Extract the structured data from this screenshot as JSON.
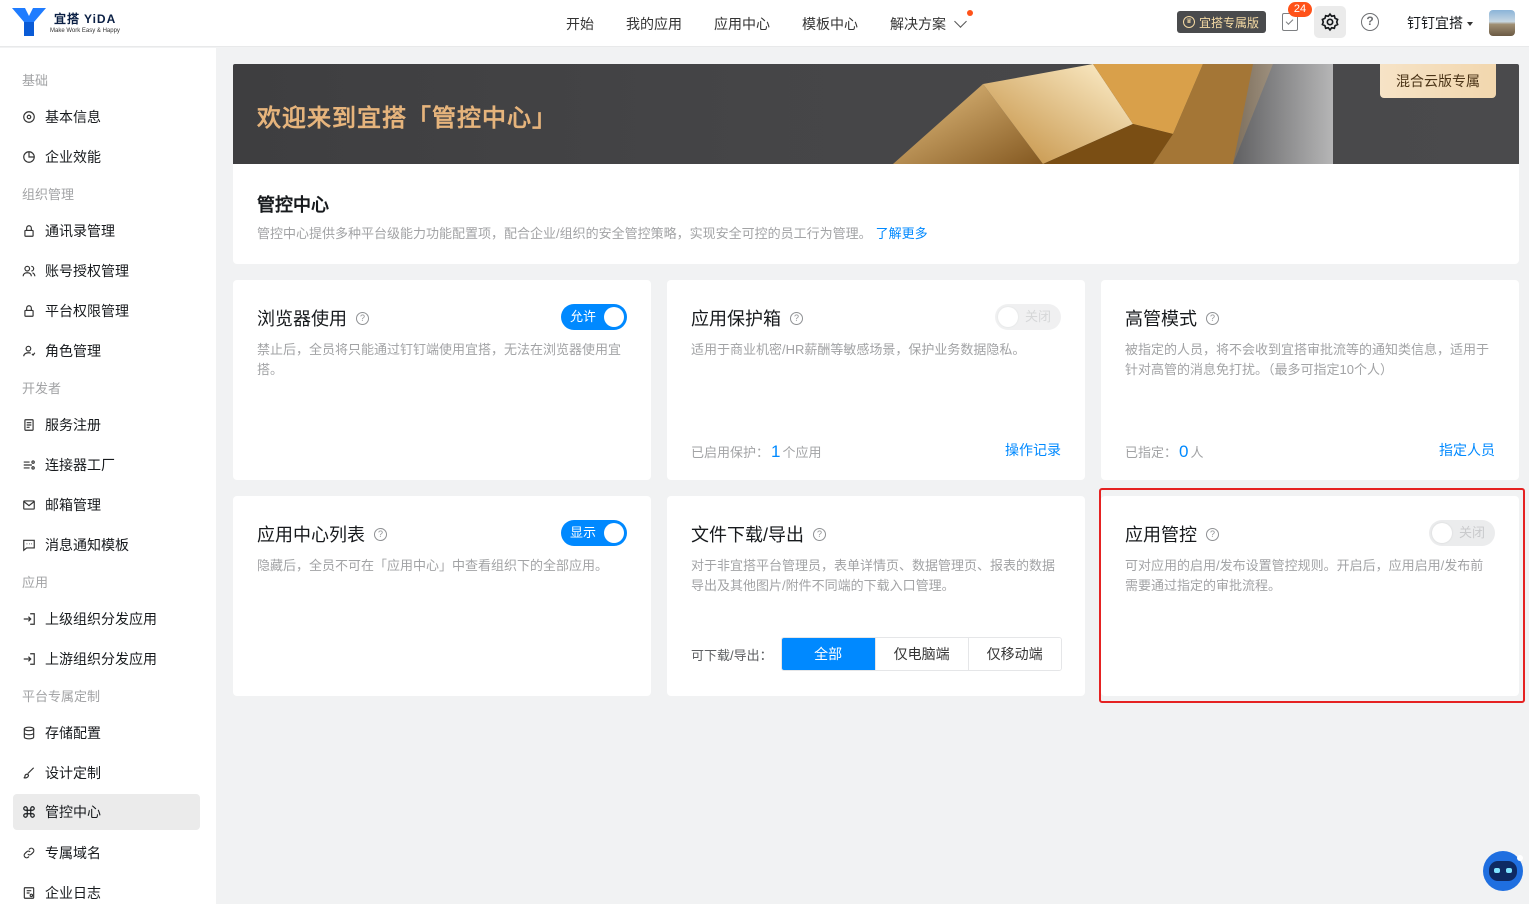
{
  "brand": {
    "name": "宜搭",
    "latin": "YiDA",
    "tagline": "Make Work Easy & Happy",
    "color": "#1f7cff"
  },
  "nav": [
    {
      "label": "开始"
    },
    {
      "label": "我的应用"
    },
    {
      "label": "应用中心"
    },
    {
      "label": "模板中心"
    },
    {
      "label": "解决方案"
    }
  ],
  "header": {
    "exclusive_badge": "宜搭专属版",
    "todo_count": "24",
    "help_glyph": "?",
    "org_name": "钉钉宜搭"
  },
  "sidebar": {
    "groups": [
      {
        "label": "基础"
      },
      {
        "label": "组织管理"
      },
      {
        "label": "开发者"
      },
      {
        "label": "应用"
      },
      {
        "label": "平台专属定制"
      }
    ],
    "items": [
      {
        "label": "基本信息",
        "icon": "gear-icon"
      },
      {
        "label": "企业效能",
        "icon": "chart-icon"
      },
      {
        "label": "通讯录管理",
        "icon": "lock-icon"
      },
      {
        "label": "账号授权管理",
        "icon": "users-icon"
      },
      {
        "label": "平台权限管理",
        "icon": "lock-icon"
      },
      {
        "label": "角色管理",
        "icon": "user-icon"
      },
      {
        "label": "服务注册",
        "icon": "document-icon"
      },
      {
        "label": "连接器工厂",
        "icon": "connector-icon"
      },
      {
        "label": "邮箱管理",
        "icon": "mail-icon"
      },
      {
        "label": "消息通知模板",
        "icon": "message-icon"
      },
      {
        "label": "上级组织分发应用",
        "icon": "import-icon"
      },
      {
        "label": "上游组织分发应用",
        "icon": "import-icon"
      },
      {
        "label": "存储配置",
        "icon": "database-icon"
      },
      {
        "label": "设计定制",
        "icon": "brush-icon"
      },
      {
        "label": "管控中心",
        "icon": "command-icon",
        "active": true
      },
      {
        "label": "专属域名",
        "icon": "link-icon"
      },
      {
        "label": "企业日志",
        "icon": "log-icon"
      }
    ]
  },
  "banner": {
    "title": "欢迎来到宜搭「管控中心」",
    "tag": "混合云版专属"
  },
  "info": {
    "title": "管控中心",
    "desc": "管控中心提供多种平台级能力功能配置项，配合企业/组织的安全管控策略，实现安全可控的员工行为管理。",
    "link": "了解更多"
  },
  "cards": {
    "browser": {
      "title": "浏览器使用",
      "toggle": "允许",
      "desc": "禁止后，全员将只能通过钉钉端使用宜搭，无法在浏览器使用宜搭。"
    },
    "protect": {
      "title": "应用保护箱",
      "toggle": "关闭",
      "desc": "适用于商业机密/HR薪酬等敏感场景，保护业务数据隐私。",
      "foot_prefix": "已启用保护：",
      "foot_num": "1",
      "foot_suffix": "个应用",
      "link": "操作记录"
    },
    "executive": {
      "title": "高管模式",
      "desc": "被指定的人员，将不会收到宜搭审批流等的通知类信息，适用于针对高管的消息免打扰。（最多可指定10个人）",
      "foot_prefix": "已指定：",
      "foot_num": "0",
      "foot_suffix": "人",
      "link": "指定人员"
    },
    "applist": {
      "title": "应用中心列表",
      "toggle": "显示",
      "desc": "隐藏后，全员不可在「应用中心」中查看组织下的全部应用。"
    },
    "download": {
      "title": "文件下载/导出",
      "desc": "对于非宜搭平台管理员，表单详情页、数据管理页、报表的数据导出及其他图片/附件不同端的下载入口管理。",
      "seg_label": "可下载/导出：",
      "options": [
        "全部",
        "仅电脑端",
        "仅移动端"
      ],
      "selected": "全部"
    },
    "appcontrol": {
      "title": "应用管控",
      "toggle": "关闭",
      "desc": "可对应用的启用/发布设置管控规则。开启后，应用启用/发布前需要通过指定的审批流程。"
    }
  },
  "colors": {
    "accent": "#0089ff",
    "highlight": "#e52222",
    "banner_text": "#e6b47c"
  }
}
